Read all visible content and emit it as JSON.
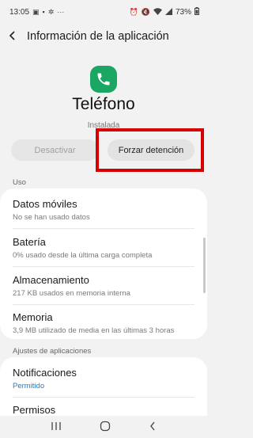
{
  "status_bar": {
    "time": "13:05",
    "left_icons": [
      "image-icon",
      "sim-icon",
      "settings-icon",
      "more-icon"
    ],
    "battery": "73%"
  },
  "app_bar": {
    "title": "Información de la aplicación"
  },
  "app": {
    "name": "Teléfono",
    "status": "Instalada",
    "icon_color": "#1aa663"
  },
  "buttons": {
    "disable": "Desactivar",
    "force_stop": "Forzar detención"
  },
  "highlight_color": "#d60000",
  "sections": {
    "usage": {
      "label": "Uso",
      "items": [
        {
          "title": "Datos móviles",
          "subtitle": "No se han usado datos"
        },
        {
          "title": "Batería",
          "subtitle": "0% usado desde la última carga completa"
        },
        {
          "title": "Almacenamiento",
          "subtitle": "217 KB usados en memoria interna"
        },
        {
          "title": "Memoria",
          "subtitle": "3,9 MB utilizado de media en las últimas 3 horas"
        }
      ]
    },
    "app_settings": {
      "label": "Ajustes de aplicaciones",
      "items": [
        {
          "title": "Notificaciones",
          "subtitle": "Permitido"
        },
        {
          "title": "Permisos",
          "subtitle": ""
        }
      ]
    }
  },
  "nav_bar": {
    "recents": "|||",
    "home": "○",
    "back": "‹"
  }
}
